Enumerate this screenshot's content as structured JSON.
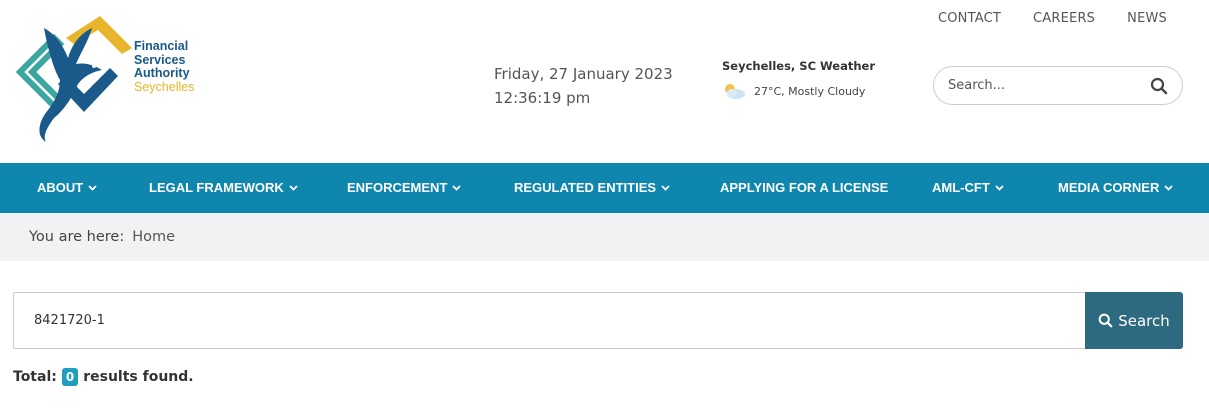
{
  "top_links": [
    "CONTACT",
    "CAREERS",
    "NEWS"
  ],
  "logo": {
    "line1": "Financial",
    "line2": "Services",
    "line3": "Authority",
    "line4": "Seychelles",
    "colors": {
      "blue": "#1a5a8a",
      "gold": "#e8b52b",
      "teal": "#3aa6a0"
    }
  },
  "datetime": {
    "date": "Friday, 27 January 2023",
    "time": "12:36:19 pm"
  },
  "weather": {
    "title": "Seychelles, SC Weather",
    "summary": "27°C, Mostly Cloudy",
    "icon": "partly-cloudy-icon"
  },
  "header_search": {
    "placeholder": "Search...",
    "icon": "search-icon"
  },
  "nav": {
    "background": "#0e86ad",
    "items": [
      {
        "label": "ABOUT",
        "dropdown": true
      },
      {
        "label": "LEGAL FRAMEWORK",
        "dropdown": true
      },
      {
        "label": "ENFORCEMENT",
        "dropdown": true
      },
      {
        "label": "REGULATED ENTITIES",
        "dropdown": true
      },
      {
        "label": "APPLYING FOR A LICENSE",
        "dropdown": false
      },
      {
        "label": "AML-CFT",
        "dropdown": true
      },
      {
        "label": "MEDIA CORNER",
        "dropdown": true
      }
    ]
  },
  "breadcrumb": {
    "prefix": "You are here:",
    "current": "Home"
  },
  "main_search": {
    "value": "8421720-1",
    "button_label": "Search",
    "button_color": "#2d6a80"
  },
  "results": {
    "prefix": "Total:",
    "count": "0",
    "suffix": "results found.",
    "badge_color": "#1e9fbf"
  }
}
